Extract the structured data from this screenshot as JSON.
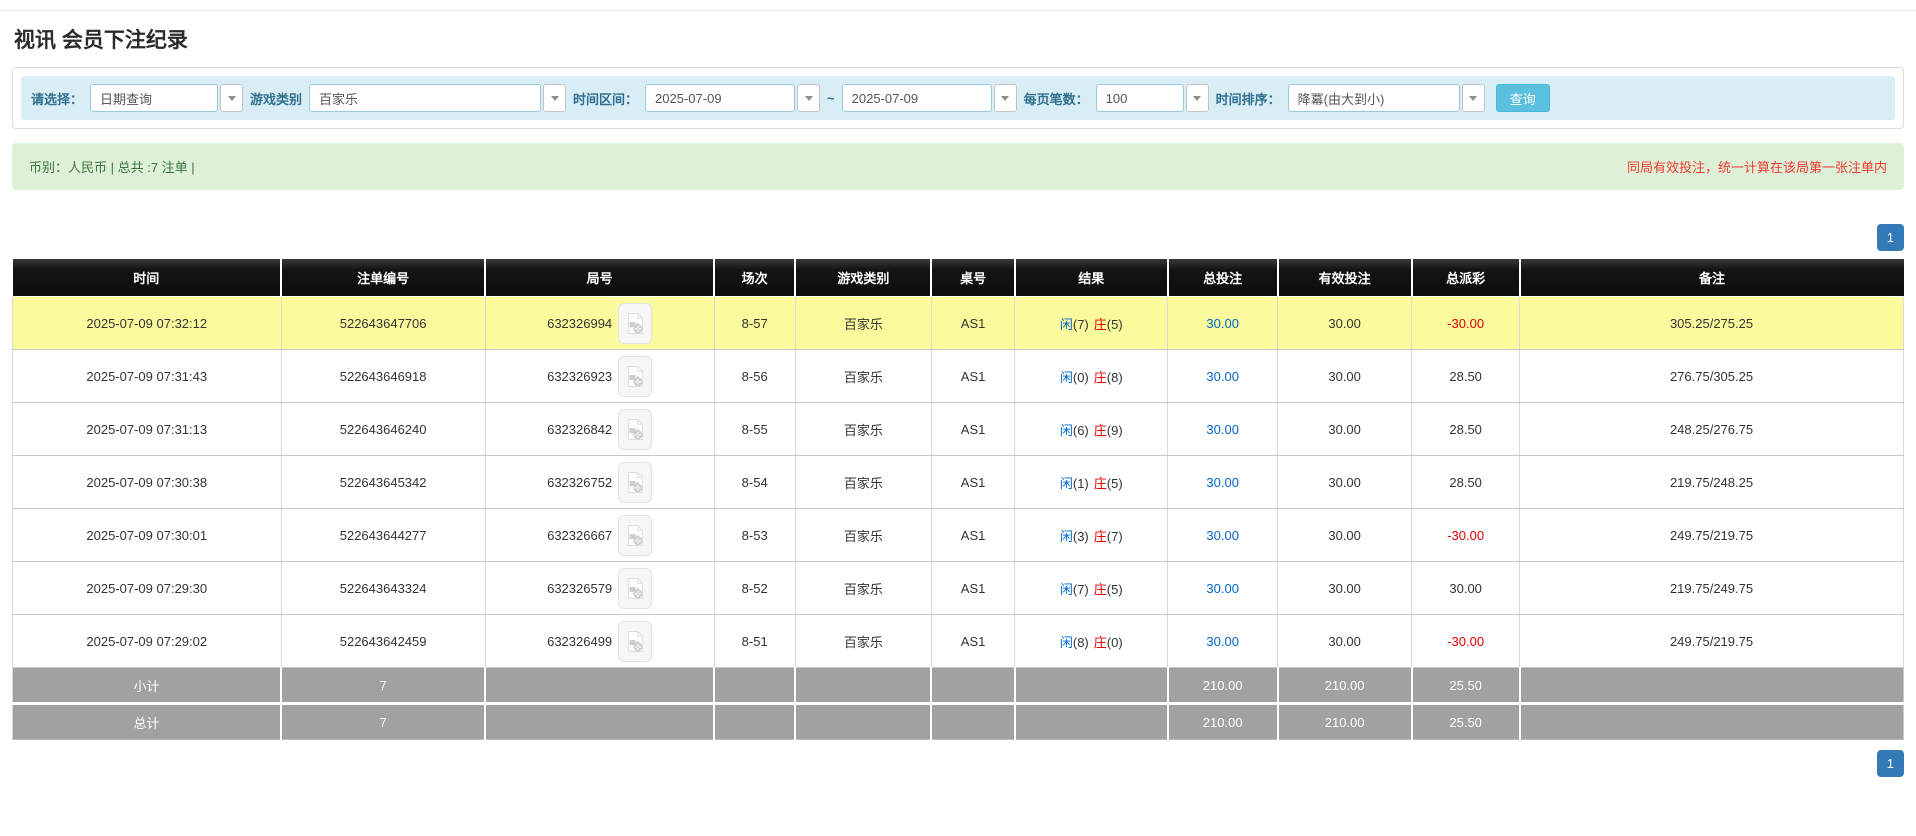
{
  "page": {
    "title": "视讯 会员下注纪录"
  },
  "filter": {
    "select_label": "请选择：",
    "select_value": "日期查询",
    "game_label": "游戏类别",
    "game_value": "百家乐",
    "range_label": "时间区间：",
    "date_from": "2025-07-09",
    "range_separator": "~",
    "date_to": "2025-07-09",
    "per_page_label": "每页笔数：",
    "per_page_value": "100",
    "sort_label": "时间排序：",
    "sort_value": "降冪(由大到小)",
    "search_button": "查询"
  },
  "summary": {
    "left": "币别：人民币 | 总共 :7 注单 |",
    "right": "同局有效投注，统一计算在该局第一张注单内"
  },
  "pagination": {
    "page": "1"
  },
  "colors": {
    "accent_blue": "#0066cc",
    "negative_red": "#e60000",
    "notice_red": "#ed3b2f",
    "highlight_yellow": "#fbfb9e",
    "header_black": "#0d0d0d",
    "subtotal_gray": "#a1a1a1",
    "search_button_blue": "#5bc0de",
    "pagination_blue": "#337ab7"
  },
  "bet_table": {
    "headers": [
      "时间",
      "注单编号",
      "局号",
      "场次",
      "游戏类别",
      "桌号",
      "结果",
      "总投注",
      "有效投注",
      "总派彩",
      "备注"
    ],
    "result_labels": {
      "player": "闲",
      "banker": "庄"
    },
    "rows": [
      {
        "time": "2025-07-09 07:32:12",
        "bet_id": "522643647706",
        "round": "632326994",
        "session": "8-57",
        "game": "百家乐",
        "table_no": "AS1",
        "player_score": "(7)",
        "banker_score": "(5)",
        "total_bet": "30.00",
        "valid_bet": "30.00",
        "payout": "-30.00",
        "remark": "305.25/275.25"
      },
      {
        "time": "2025-07-09 07:31:43",
        "bet_id": "522643646918",
        "round": "632326923",
        "session": "8-56",
        "game": "百家乐",
        "table_no": "AS1",
        "player_score": "(0)",
        "banker_score": "(8)",
        "total_bet": "30.00",
        "valid_bet": "30.00",
        "payout": "28.50",
        "remark": "276.75/305.25"
      },
      {
        "time": "2025-07-09 07:31:13",
        "bet_id": "522643646240",
        "round": "632326842",
        "session": "8-55",
        "game": "百家乐",
        "table_no": "AS1",
        "player_score": "(6)",
        "banker_score": "(9)",
        "total_bet": "30.00",
        "valid_bet": "30.00",
        "payout": "28.50",
        "remark": "248.25/276.75"
      },
      {
        "time": "2025-07-09 07:30:38",
        "bet_id": "522643645342",
        "round": "632326752",
        "session": "8-54",
        "game": "百家乐",
        "table_no": "AS1",
        "player_score": "(1)",
        "banker_score": "(5)",
        "total_bet": "30.00",
        "valid_bet": "30.00",
        "payout": "28.50",
        "remark": "219.75/248.25"
      },
      {
        "time": "2025-07-09 07:30:01",
        "bet_id": "522643644277",
        "round": "632326667",
        "session": "8-53",
        "game": "百家乐",
        "table_no": "AS1",
        "player_score": "(3)",
        "banker_score": "(7)",
        "total_bet": "30.00",
        "valid_bet": "30.00",
        "payout": "-30.00",
        "remark": "249.75/219.75"
      },
      {
        "time": "2025-07-09 07:29:30",
        "bet_id": "522643643324",
        "round": "632326579",
        "session": "8-52",
        "game": "百家乐",
        "table_no": "AS1",
        "player_score": "(7)",
        "banker_score": "(5)",
        "total_bet": "30.00",
        "valid_bet": "30.00",
        "payout": "30.00",
        "remark": "219.75/249.75"
      },
      {
        "time": "2025-07-09 07:29:02",
        "bet_id": "522643642459",
        "round": "632326499",
        "session": "8-51",
        "game": "百家乐",
        "table_no": "AS1",
        "player_score": "(8)",
        "banker_score": "(0)",
        "total_bet": "30.00",
        "valid_bet": "30.00",
        "payout": "-30.00",
        "remark": "249.75/219.75"
      }
    ],
    "footer": [
      {
        "label": "小计",
        "count": "7",
        "total_bet": "210.00",
        "valid_bet": "210.00",
        "payout": "25.50"
      },
      {
        "label": "总计",
        "count": "7",
        "total_bet": "210.00",
        "valid_bet": "210.00",
        "payout": "25.50"
      }
    ]
  }
}
